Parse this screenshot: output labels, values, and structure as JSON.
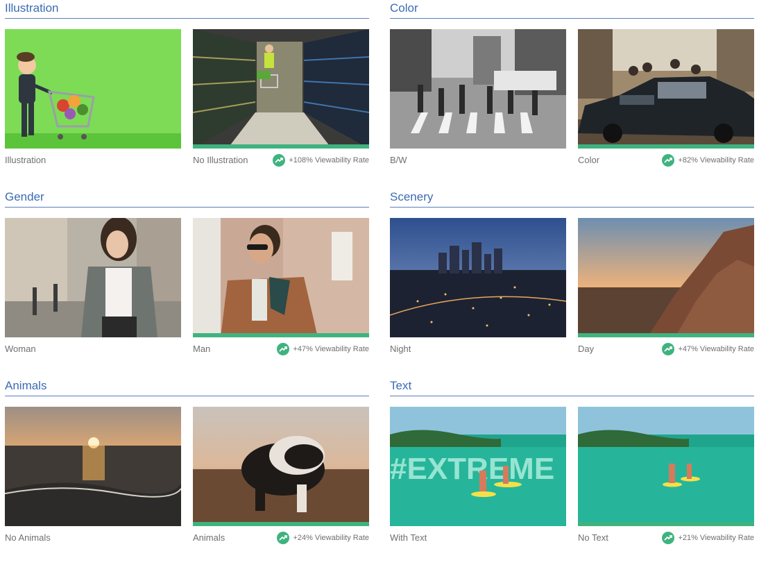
{
  "sections": [
    {
      "title": "Illustration",
      "left": {
        "caption": "Illustration",
        "image_icon": "cartoon-shopper-icon"
      },
      "right": {
        "caption": "No Illustration",
        "image_icon": "supermarket-aisle-icon",
        "lift": "+108% Viewability Rate"
      }
    },
    {
      "title": "Color",
      "left": {
        "caption": "B/W",
        "image_icon": "bw-street-icon"
      },
      "right": {
        "caption": "Color",
        "image_icon": "color-street-car-icon",
        "lift": "+82% Viewability Rate"
      }
    },
    {
      "title": "Gender",
      "left": {
        "caption": "Woman",
        "image_icon": "woman-portrait-icon"
      },
      "right": {
        "caption": "Man",
        "image_icon": "man-portrait-icon",
        "lift": "+47% Viewability Rate"
      }
    },
    {
      "title": "Scenery",
      "left": {
        "caption": "Night",
        "image_icon": "city-night-icon"
      },
      "right": {
        "caption": "Day",
        "image_icon": "rock-sunset-icon",
        "lift": "+47% Viewability Rate"
      }
    },
    {
      "title": "Animals",
      "left": {
        "caption": "No Animals",
        "image_icon": "beach-sunset-icon"
      },
      "right": {
        "caption": "Animals",
        "image_icon": "puppy-beach-icon",
        "lift": "+24% Viewability Rate"
      }
    },
    {
      "title": "Text",
      "left": {
        "caption": "With Text",
        "image_icon": "paddleboard-text-icon",
        "overlay_text": "#EXTREME"
      },
      "right": {
        "caption": "No Text",
        "image_icon": "paddleboard-icon",
        "lift": "+21% Viewability Rate"
      }
    }
  ],
  "colors": {
    "title": "#3b6bb3",
    "winner_bar": "#3fb37f",
    "caption": "#6f6f6f"
  }
}
